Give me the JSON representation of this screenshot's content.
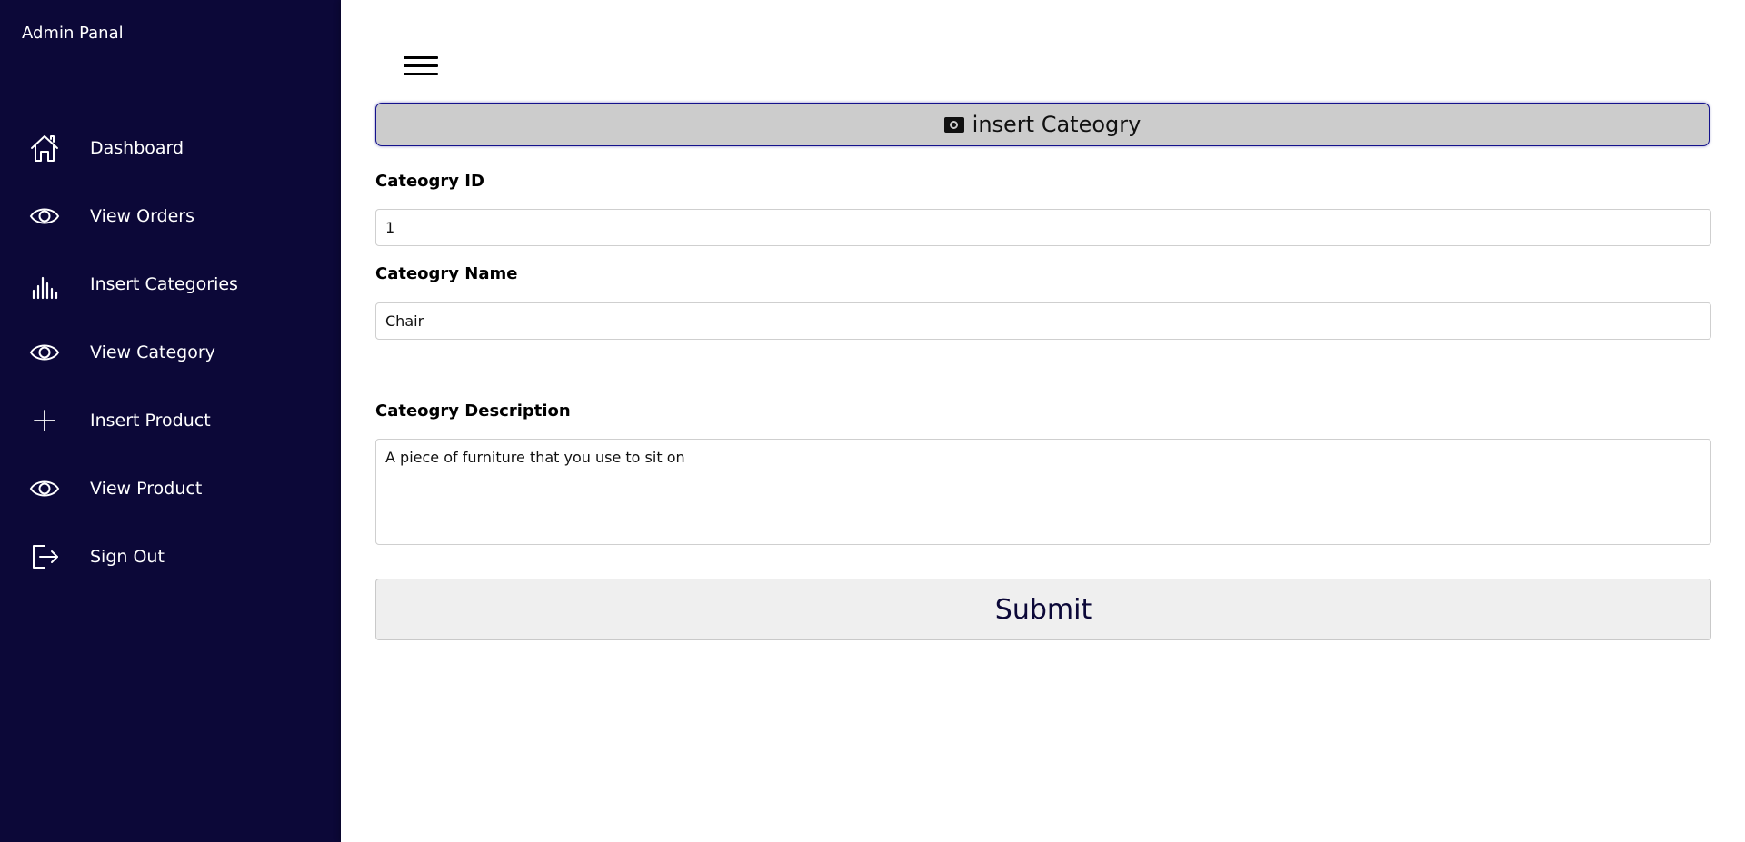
{
  "sidebar": {
    "brand": "Admin Panal",
    "items": [
      {
        "label": "Dashboard",
        "icon": "home-icon"
      },
      {
        "label": "View Orders",
        "icon": "eye-icon"
      },
      {
        "label": "Insert Categories",
        "icon": "bar-chart-icon"
      },
      {
        "label": "View Category",
        "icon": "eye-icon"
      },
      {
        "label": "Insert Product",
        "icon": "plus-icon"
      },
      {
        "label": "View Product",
        "icon": "eye-icon"
      },
      {
        "label": "Sign Out",
        "icon": "sign-out-icon"
      }
    ]
  },
  "main": {
    "menu_icon": "hamburger-icon",
    "form": {
      "header_title": "insert Cateogry",
      "header_icon": "money-icon",
      "id_label": "Cateogry ID",
      "id_value": "1",
      "name_label": "Cateogry Name",
      "name_value": "Chair",
      "description_label": "Cateogry Description",
      "description_value": "A piece of furniture that you use to sit on",
      "submit_label": "Submit"
    }
  },
  "colors": {
    "sidebar_bg": "#0c0838",
    "header_bg": "#cccccc",
    "header_border": "#14128c",
    "submit_text": "#0c0838"
  }
}
